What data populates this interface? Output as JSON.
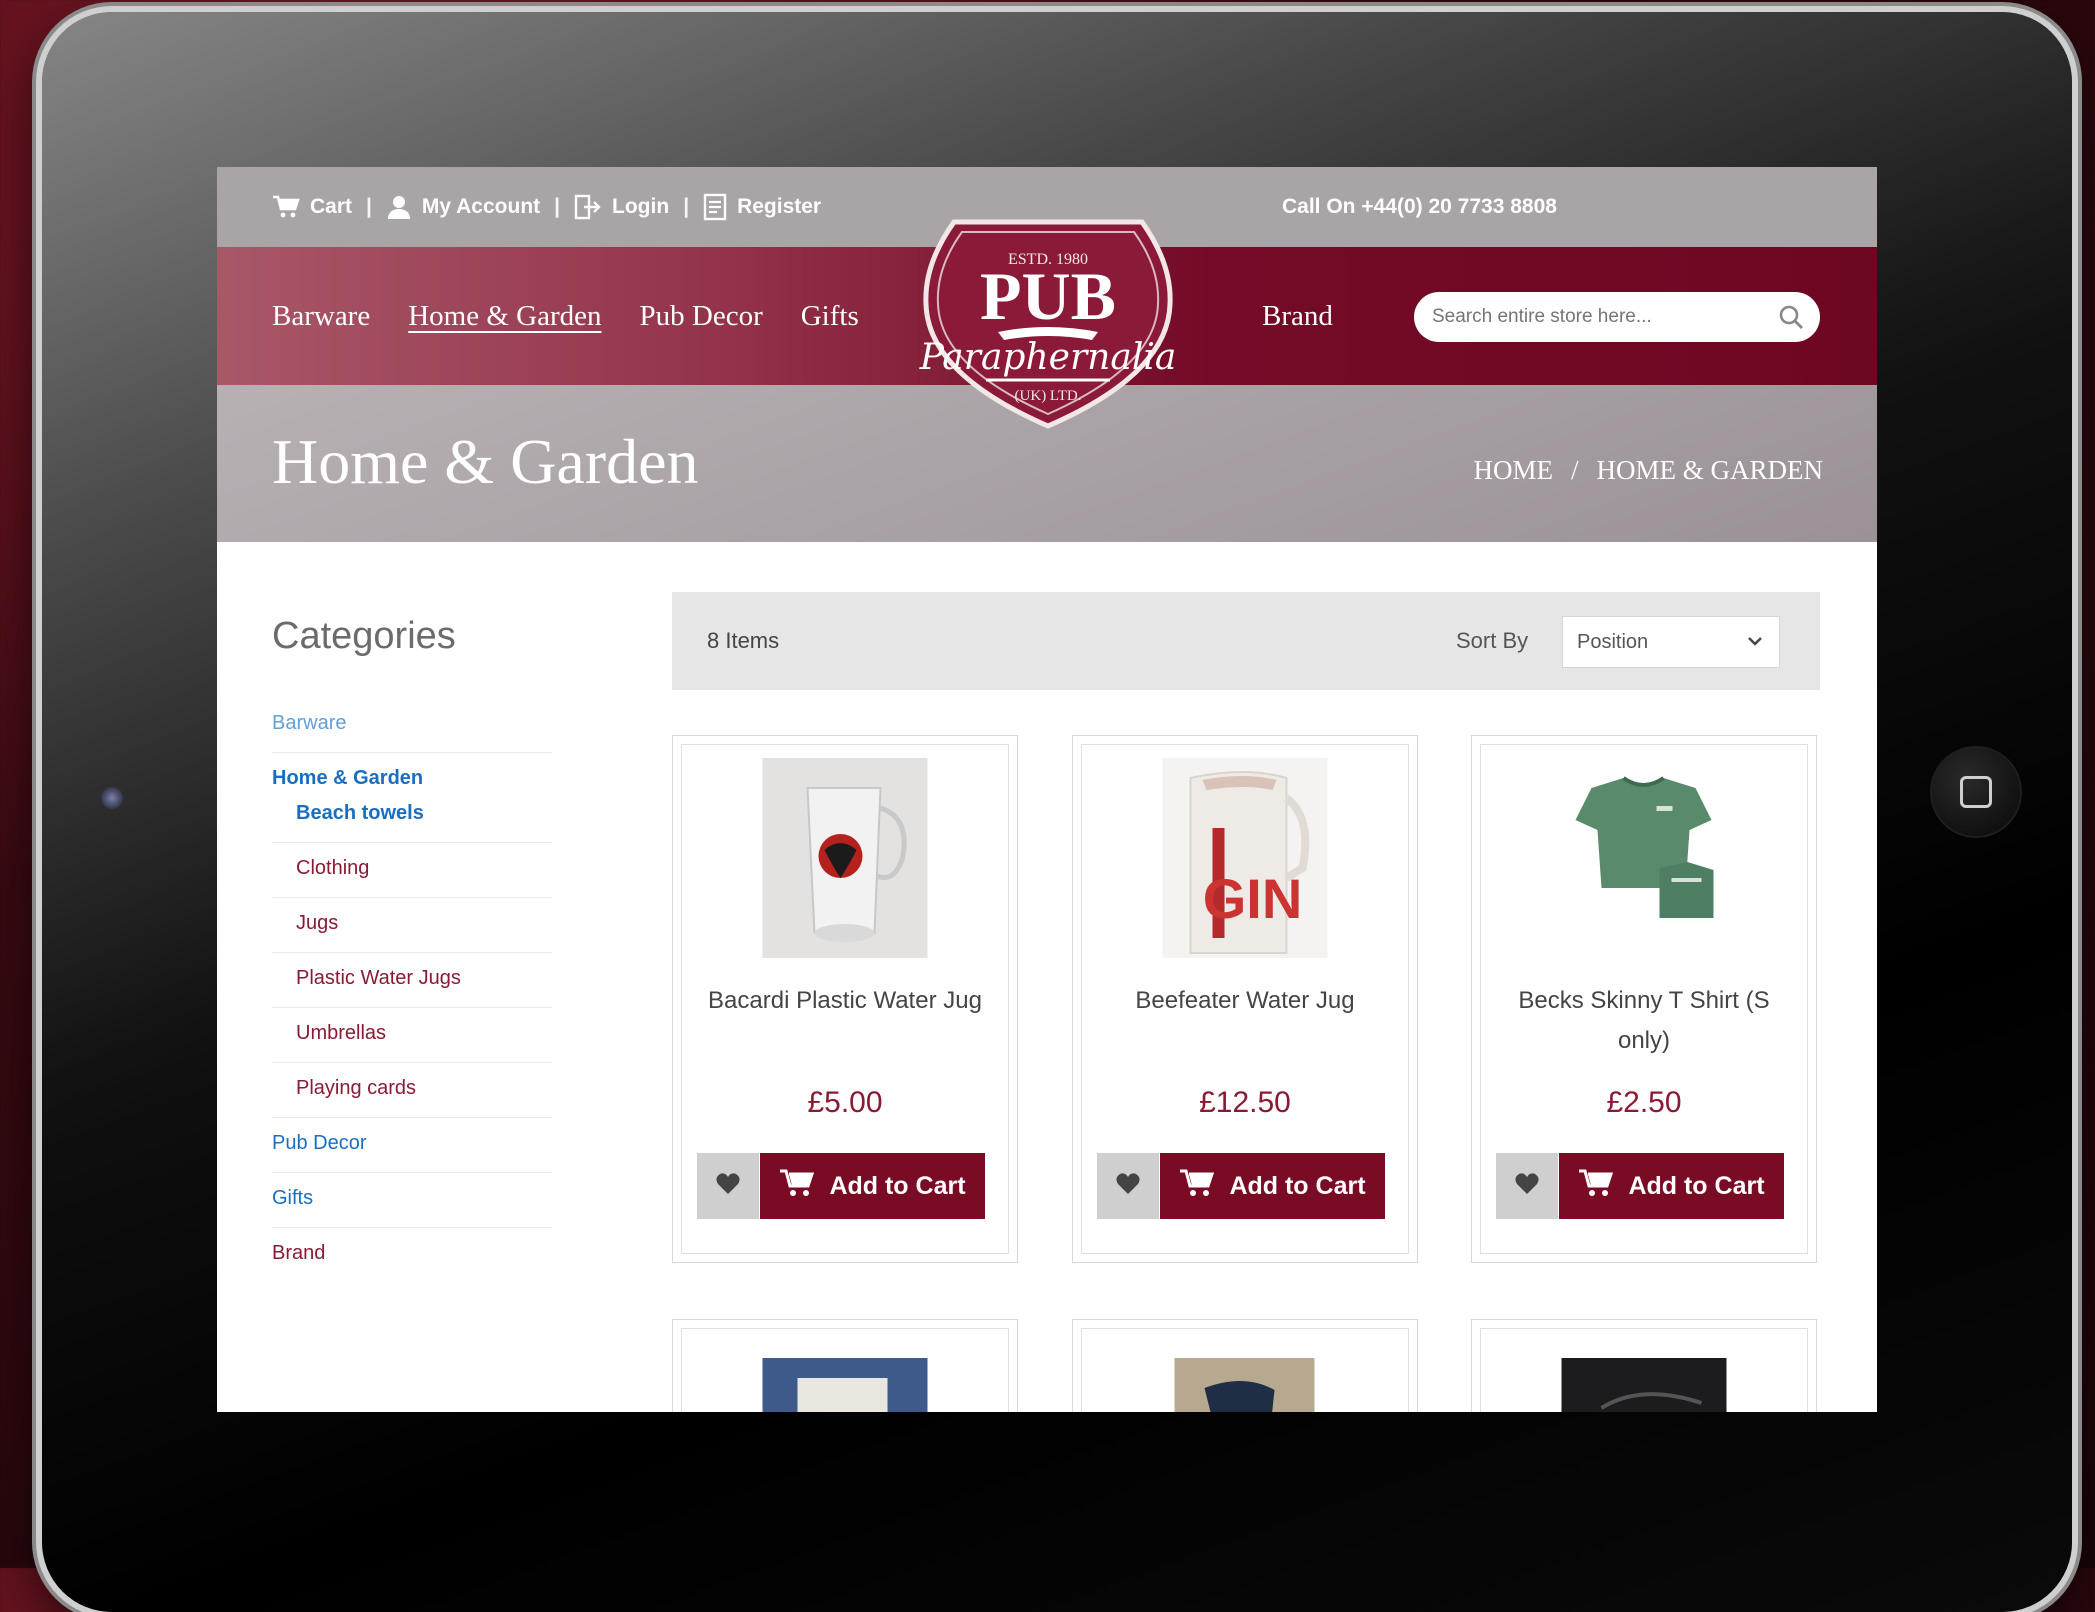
{
  "topbar": {
    "cart": "Cart",
    "account": "My Account",
    "login": "Login",
    "register": "Register",
    "separator": "|",
    "phone": "Call On +44(0) 20 7733 8808"
  },
  "nav": {
    "items": [
      "Barware",
      "Home & Garden",
      "Pub Decor",
      "Gifts"
    ],
    "brand": "Brand",
    "search_placeholder": "Search entire store here..."
  },
  "logo": {
    "top": "ESTD. 1980",
    "main": "PUB",
    "script": "Paraphernalia",
    "bottom": "(UK) LTD."
  },
  "hero": {
    "title": "Home & Garden",
    "breadcrumb_home": "HOME",
    "breadcrumb_sep": "/",
    "breadcrumb_current": "HOME & GARDEN"
  },
  "sidebar": {
    "title": "Categories",
    "items": [
      {
        "label": "Barware"
      },
      {
        "label": "Home & Garden"
      },
      {
        "label": "Beach towels"
      },
      {
        "label": "Clothing"
      },
      {
        "label": "Jugs"
      },
      {
        "label": "Plastic Water Jugs"
      },
      {
        "label": "Umbrellas"
      },
      {
        "label": "Playing cards"
      },
      {
        "label": "Pub Decor"
      },
      {
        "label": "Gifts"
      },
      {
        "label": "Brand"
      }
    ]
  },
  "toolbar": {
    "count": "8 Items",
    "sort_label": "Sort By",
    "sort_value": "Position"
  },
  "products": [
    {
      "name": "Bacardi Plastic Water Jug",
      "price": "£5.00",
      "cta": "Add to Cart"
    },
    {
      "name": "Beefeater Water Jug",
      "price": "£12.50",
      "cta": "Add to Cart"
    },
    {
      "name": "Becks Skinny T Shirt (S only)",
      "price": "£2.50",
      "cta": "Add to Cart"
    }
  ],
  "product_labels": {
    "beefeater_jug_text": "GIN"
  },
  "colors": {
    "brand": "#7a0b25",
    "topbar": "#a9a4a6",
    "link_blue": "#1a6ec2"
  }
}
